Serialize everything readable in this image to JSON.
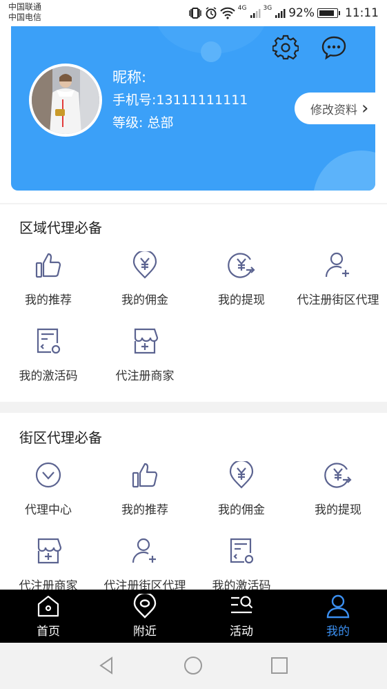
{
  "status_bar": {
    "carrier1": "中国联通",
    "carrier2": "中国电信",
    "network1": "4G",
    "network2": "3G",
    "battery": "92%",
    "battery_level": 0.92,
    "time": "11:11"
  },
  "profile": {
    "nickname": "昵称:",
    "phone": "手机号:13111111111",
    "level": "等级: 总部",
    "edit_label": "修改资料",
    "edit_arrow": "›"
  },
  "section_regional": {
    "title": "区域代理必备",
    "items": [
      {
        "label": "我的推荐",
        "icon": "thumbs-up-icon"
      },
      {
        "label": "我的佣金",
        "icon": "yuan-pin-icon"
      },
      {
        "label": "我的提现",
        "icon": "withdraw-icon"
      },
      {
        "label": "代注册街区代理",
        "icon": "add-user-icon"
      },
      {
        "label": "我的激活码",
        "icon": "activation-code-icon"
      },
      {
        "label": "代注册商家",
        "icon": "store-add-icon"
      }
    ]
  },
  "section_street": {
    "title": "街区代理必备",
    "items": [
      {
        "label": "代理中心",
        "icon": "agent-center-icon"
      },
      {
        "label": "我的推荐",
        "icon": "thumbs-up-icon"
      },
      {
        "label": "我的佣金",
        "icon": "yuan-pin-icon"
      },
      {
        "label": "我的提现",
        "icon": "withdraw-icon"
      },
      {
        "label": "代注册商家",
        "icon": "store-add-icon"
      },
      {
        "label": "代注册街区代理",
        "icon": "add-user-icon"
      },
      {
        "label": "我的激活码",
        "icon": "activation-code-icon"
      }
    ]
  },
  "tabbar": {
    "tabs": [
      {
        "label": "首页",
        "icon": "home-icon"
      },
      {
        "label": "附近",
        "icon": "location-icon"
      },
      {
        "label": "活动",
        "icon": "activity-search-icon"
      },
      {
        "label": "我的",
        "icon": "user-icon"
      }
    ],
    "active_index": 3
  },
  "colors": {
    "accent": "#3ba0f8",
    "icon_stroke": "#5b6390",
    "tab_active": "#3b8ff0"
  }
}
